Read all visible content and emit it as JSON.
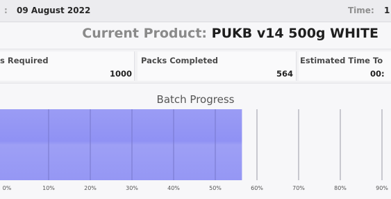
{
  "header": {
    "date_prefix": ":",
    "date": "09 August 2022",
    "time_label": "Time:",
    "time_value": "1"
  },
  "product": {
    "label": "Current Product:",
    "name": "PUKB v14 500g WHITE"
  },
  "stats": [
    {
      "label": "s Required",
      "value": "1000"
    },
    {
      "label": "Packs Completed",
      "value": "564"
    },
    {
      "label": "Estimated Time To",
      "value": "00:"
    }
  ],
  "progress": {
    "title": "Batch Progress",
    "percent": 56.4,
    "fill_color": "#8a8cf4",
    "tick_labels": [
      "0%",
      "10%",
      "20%",
      "30%",
      "40%",
      "50%",
      "60%",
      "70%",
      "80%",
      "90%"
    ]
  }
}
